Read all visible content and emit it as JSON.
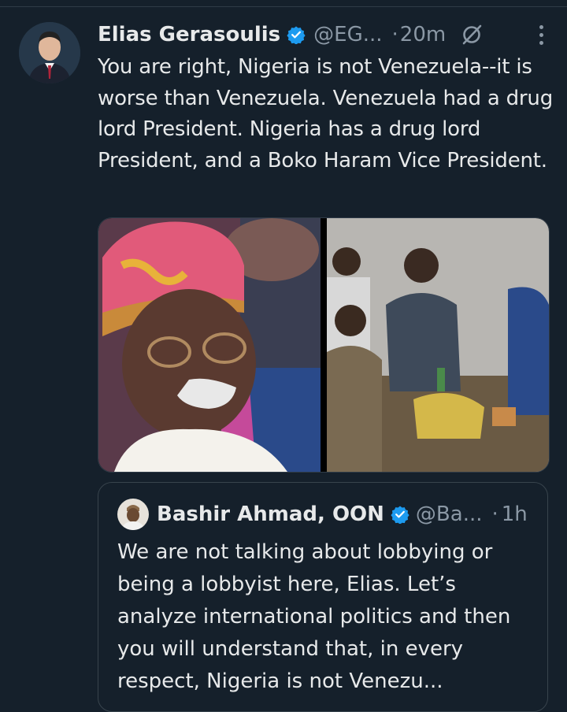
{
  "tweet": {
    "author_name": "Elias Gerasoulis",
    "handle": "@EG...",
    "separator": "·",
    "time": "20m",
    "text": "You are right, Nigeria is not Venezuela--it is worse than Venezuela.  Venezuela had a drug lord President. Nigeria has a drug lord President, and a Boko Haram Vice President."
  },
  "quote": {
    "author_name": "Bashir Ahmad, OON",
    "handle": "@Ba...",
    "separator": "·",
    "time": "1h",
    "text": "We are not talking about lobbying or being a lobbyist here, Elias. Let’s analyze international politics and then you will understand that, in every respect, Nigeria is not Venezu..."
  },
  "icons": {
    "verified": "verified-badge-icon",
    "grok": "grok-icon",
    "more": "more-options-icon"
  },
  "colors": {
    "background": "#15202b",
    "text": "#e7e9ea",
    "secondary": "#8b98a5",
    "verified": "#1d9bf0",
    "border": "#38444d"
  }
}
